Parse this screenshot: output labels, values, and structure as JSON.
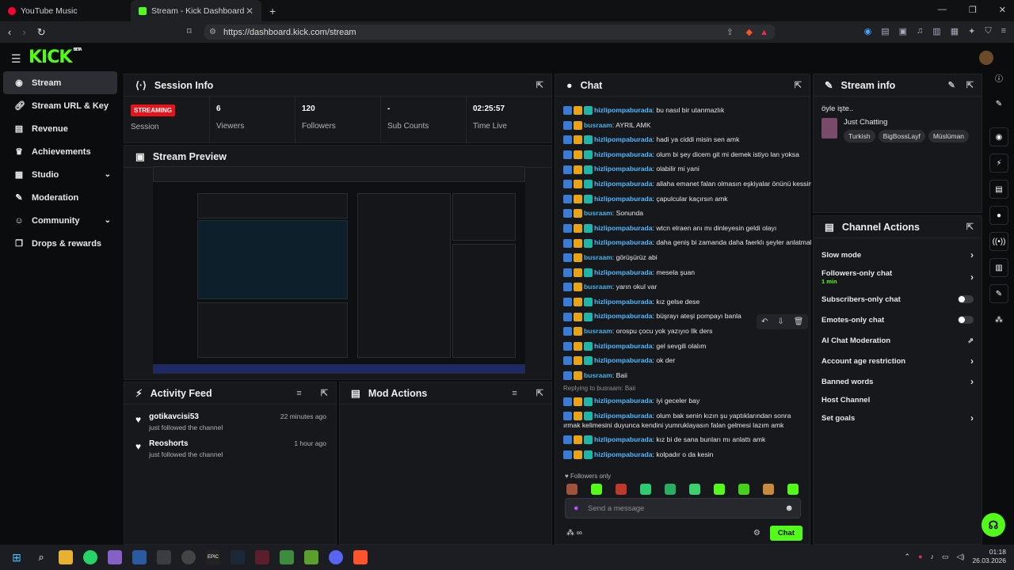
{
  "browser": {
    "tabs": [
      {
        "label": "YouTube Music",
        "color": "#ff0033"
      },
      {
        "label": "Stream - Kick Dashboard",
        "color": "#53fc18"
      }
    ],
    "url": "https://dashboard.kick.com/stream"
  },
  "app": {
    "logo": "KICK",
    "logo_badge": "BETA",
    "accent": "#53fc18"
  },
  "sidebar": {
    "items": [
      {
        "label": "Stream",
        "icon": "broadcast-icon"
      },
      {
        "label": "Stream URL & Key",
        "icon": "link-icon"
      },
      {
        "label": "Revenue",
        "icon": "chart-icon"
      },
      {
        "label": "Achievements",
        "icon": "trophy-icon"
      },
      {
        "label": "Studio",
        "icon": "studio-icon"
      },
      {
        "label": "Moderation",
        "icon": "wrench-icon"
      },
      {
        "label": "Community",
        "icon": "community-icon"
      },
      {
        "label": "Drops & rewards",
        "icon": "gift-icon"
      }
    ]
  },
  "session": {
    "title": "Session Info",
    "status_badge": "STREAMING",
    "status_label": "Session",
    "viewers": "6",
    "viewers_label": "Viewers",
    "followers": "120",
    "followers_label": "Followers",
    "subs": "-",
    "subs_label": "Sub Counts",
    "time": "02:25:57",
    "time_label": "Time Live"
  },
  "preview": {
    "title": "Stream Preview"
  },
  "feed": {
    "title": "Activity Feed",
    "items": [
      {
        "name": "gotikavcisi53",
        "sub": "just followed the channel",
        "time": "22 minutes ago"
      },
      {
        "name": "Reoshorts",
        "sub": "just followed the channel",
        "time": "1 hour ago"
      }
    ]
  },
  "mod": {
    "title": "Mod Actions"
  },
  "chat": {
    "title": "Chat",
    "messages": [
      {
        "u": "hizlipompaburada",
        "t": "bu nasıl bir utanmazlık"
      },
      {
        "u": "busraam",
        "t": "AYRIL AMK"
      },
      {
        "u": "hizlipompaburada",
        "t": "hadi ya ciddi misin sen amk"
      },
      {
        "u": "hizlipompaburada",
        "t": "olum bi şey dicem git mi demek istiyo lan yoksa"
      },
      {
        "u": "hizlipompaburada",
        "t": "olabilir mi yani"
      },
      {
        "u": "hizlipompaburada",
        "t": "allaha emanet falan olmasın eşkiyalar önünü kessin amk"
      },
      {
        "u": "hizlipompaburada",
        "t": "çapulcular kaçırsın amk"
      },
      {
        "u": "busraam",
        "t": "Sonunda"
      },
      {
        "u": "hizlipompaburada",
        "t": "wtcn elraen anı mı dinleyesin geldi olayı"
      },
      {
        "u": "hizlipompaburada",
        "t": "daha geniş bi zamanda daha faerklı şeyler anlatmak üzere"
      },
      {
        "u": "busraam",
        "t": "görüşürüz abi"
      },
      {
        "u": "hizlipompaburada",
        "t": "mesela şuan"
      },
      {
        "u": "busraam",
        "t": "yarın okul var"
      },
      {
        "u": "hizlipompaburada",
        "t": "kız gelse dese"
      },
      {
        "u": "hizlipompaburada",
        "t": "büşrayı ateşi pompayı banla"
      },
      {
        "u": "busraam",
        "t": "orospu çocu yok yazıyıo llk ders"
      },
      {
        "u": "hizlipompaburada",
        "t": "gel sevgili olalım"
      },
      {
        "u": "hizlipompaburada",
        "t": "ok der"
      },
      {
        "u": "busraam",
        "t": "Baii"
      },
      {
        "u": "hizlipompaburada",
        "t": "iyi geceler bay"
      },
      {
        "u": "hizlipompaburada",
        "t": "olum bak senin kızın şu yaptıklarından sonra ırmak kelimesini duyunca kendini yumruklayasın falan gelmesi lazım amk"
      },
      {
        "u": "hizlipompaburada",
        "t": "kız bi de sana bunları mı anlattı amk"
      },
      {
        "u": "hizlipompaburada",
        "t": "kolpadır o da kesin"
      }
    ],
    "reply_note": "Replying to busraam: Baii",
    "followers_only": "Followers only",
    "placeholder": "Send a message",
    "send_label": "Chat"
  },
  "stream_info": {
    "title": "Stream info",
    "stream_title": "öyle işte..",
    "category": "Just Chatting",
    "tags": [
      "Turkish",
      "BigBossLayf",
      "Müslüman"
    ]
  },
  "channel_actions": {
    "title": "Channel Actions",
    "items": [
      {
        "label": "Slow mode",
        "kind": "chevron"
      },
      {
        "label": "Followers-only chat",
        "sub": "1 min",
        "kind": "chevron"
      },
      {
        "label": "Subscribers-only chat",
        "kind": "toggle"
      },
      {
        "label": "Emotes-only chat",
        "kind": "toggle"
      },
      {
        "label": "AI Chat Moderation",
        "kind": "external"
      },
      {
        "label": "Account age restriction",
        "kind": "chevron"
      },
      {
        "label": "Banned words",
        "kind": "chevron"
      },
      {
        "label": "Host Channel",
        "kind": "none"
      },
      {
        "label": "Set goals",
        "kind": "chevron"
      }
    ]
  },
  "taskbar": {
    "time": "01:18",
    "date": "26.03.2026"
  }
}
